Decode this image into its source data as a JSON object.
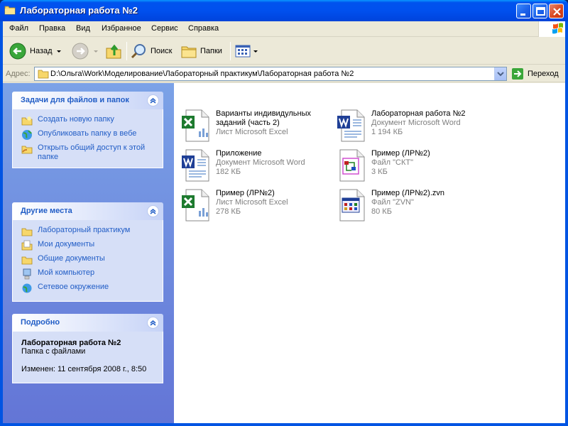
{
  "window": {
    "title": "Лабораторная работа №2"
  },
  "menu": [
    "Файл",
    "Правка",
    "Вид",
    "Избранное",
    "Сервис",
    "Справка"
  ],
  "toolbar": {
    "back": "Назад",
    "search": "Поиск",
    "folders": "Папки"
  },
  "address": {
    "label": "Адрес:",
    "path": "D:\\Ольга\\Work\\Моделирование\\Лабораторный практикум\\Лабораторная работа №2",
    "go": "Переход"
  },
  "tasks": {
    "title": "Задачи для файлов и папок",
    "items": [
      "Создать новую папку",
      "Опубликовать папку в вебе",
      "Открыть общий доступ к этой папке"
    ]
  },
  "places": {
    "title": "Другие места",
    "items": [
      "Лабораторный практикум",
      "Мои документы",
      "Общие документы",
      "Мой компьютер",
      "Сетевое окружение"
    ]
  },
  "details": {
    "title": "Подробно",
    "name": "Лабораторная работа №2",
    "type": "Папка с файлами",
    "modified": "Изменен: 11 сентября 2008 г., 8:50"
  },
  "files": [
    {
      "name": "Варианты индивидульных заданий (часть 2)",
      "type": "Лист Microsoft Excel",
      "size": "",
      "icon": "excel-icon"
    },
    {
      "name": "Лабораторная работа №2",
      "type": "Документ Microsoft Word",
      "size": "1 194 КБ",
      "icon": "word-icon"
    },
    {
      "name": "Приложение",
      "type": "Документ Microsoft Word",
      "size": "182 КБ",
      "icon": "word-icon"
    },
    {
      "name": "Пример (ЛР№2)",
      "type": "Файл \"СКТ\"",
      "size": "3 КБ",
      "icon": "ckt-file-icon"
    },
    {
      "name": "Пример (ЛР№2)",
      "type": "Лист Microsoft Excel",
      "size": "278 КБ",
      "icon": "excel-icon"
    },
    {
      "name": "Пример (ЛР№2).zvn",
      "type": "Файл \"ZVN\"",
      "size": "80 КБ",
      "icon": "zvn-file-icon"
    }
  ]
}
